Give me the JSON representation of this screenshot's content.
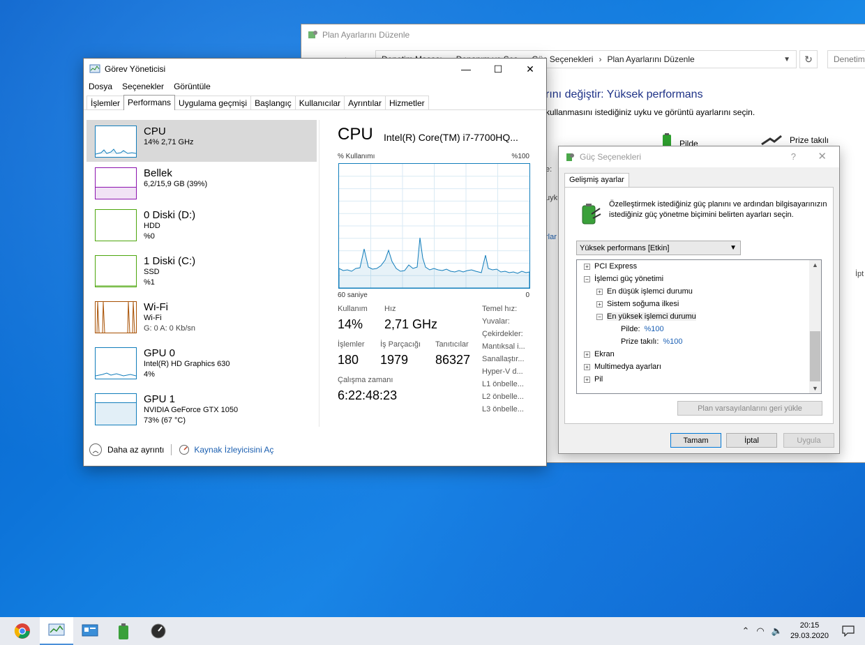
{
  "control_panel": {
    "title": "Plan Ayarlarını Düzenle",
    "breadcrumb": [
      "Denetim Masası",
      "Donanım ve Ses",
      "Güç Seçenekleri",
      "Plan Ayarlarını Düzenle"
    ],
    "search_placeholder": "Denetim",
    "heading_fragment": "rını değiştir: Yüksek performans",
    "subheading_fragment": "kullanmasını istediğiniz uyku ve görüntü ayarlarını seçin.",
    "col_battery": "Pilde",
    "col_plugged": "Prize takılı",
    "frag_1": "e:",
    "frag_2": "uyku",
    "frag_3": "rlar",
    "frag_4": "İpt"
  },
  "task_manager": {
    "title": "Görev Yöneticisi",
    "menu": [
      "Dosya",
      "Seçenekler",
      "Görüntüle"
    ],
    "tabs": [
      "İşlemler",
      "Performans",
      "Uygulama geçmişi",
      "Başlangıç",
      "Kullanıcılar",
      "Ayrıntılar",
      "Hizmetler"
    ],
    "items": [
      {
        "name": "CPU",
        "l1": "14% 2,71 GHz",
        "l2": "",
        "l3": ""
      },
      {
        "name": "Bellek",
        "l1": "6,2/15,9 GB (39%)",
        "l2": "",
        "l3": ""
      },
      {
        "name": "0 Diski (D:)",
        "l1": "HDD",
        "l2": "%0",
        "l3": ""
      },
      {
        "name": "1 Diski (C:)",
        "l1": "SSD",
        "l2": "%1",
        "l3": ""
      },
      {
        "name": "Wi-Fi",
        "l1": "Wi-Fi",
        "l2": "G: 0 A: 0 Kb/sn",
        "l3": ""
      },
      {
        "name": "GPU 0",
        "l1": "Intel(R) HD Graphics 630",
        "l2": "4%",
        "l3": ""
      },
      {
        "name": "GPU 1",
        "l1": "NVIDIA GeForce GTX 1050",
        "l2": "73% (67 °C)",
        "l3": ""
      }
    ],
    "detail": {
      "title": "CPU",
      "model": "Intel(R) Core(TM) i7-7700HQ...",
      "graph_label": "% Kullanımı",
      "graph_max": "%100",
      "axis_left": "60 saniye",
      "axis_right": "0",
      "usage_label": "Kullanım",
      "usage_value": "14%",
      "speed_label": "Hız",
      "speed_value": "2,71 GHz",
      "processes_label": "İşlemler",
      "processes_value": "180",
      "threads_label": "İş Parçacığı",
      "threads_value": "1979",
      "handles_label": "Tanıtıcılar",
      "handles_value": "86327",
      "uptime_label": "Çalışma zamanı",
      "uptime_value": "6:22:48:23",
      "side_labels": [
        "Temel hız:",
        "Yuvalar:",
        "Çekirdekler:",
        "Mantıksal i...",
        "Sanallaştır...",
        "Hyper-V d...",
        "L1 önbelle...",
        "L2 önbelle...",
        "L3 önbelle..."
      ]
    },
    "footer_less": "Daha az ayrıntı",
    "footer_link": "Kaynak İzleyicisini Aç"
  },
  "power_options": {
    "title": "Güç Seçenekleri",
    "help": "?",
    "tab": "Gelişmiş ayarlar",
    "description": "Özelleştirmek istediğiniz güç planını ve ardından bilgisayarınızın istediğiniz güç yönetme biçimini belirten ayarları seçin.",
    "plan_selected": "Yüksek performans [Etkin]",
    "tree": [
      {
        "label": "PCI Express",
        "exp": "+",
        "value": ""
      },
      {
        "label": "İşlemci güç yönetimi",
        "exp": "−",
        "value": ""
      },
      {
        "label": "En düşük işlemci durumu",
        "exp": "+",
        "value": ""
      },
      {
        "label": "Sistem soğuma ilkesi",
        "exp": "+",
        "value": ""
      },
      {
        "label": "En yüksek işlemci durumu",
        "exp": "−",
        "value": ""
      },
      {
        "label": "Pilde:",
        "exp": "",
        "value": "%100"
      },
      {
        "label": "Prize takılı:",
        "exp": "",
        "value": "%100"
      },
      {
        "label": "Ekran",
        "exp": "+",
        "value": ""
      },
      {
        "label": "Multimedya ayarları",
        "exp": "+",
        "value": ""
      },
      {
        "label": "Pil",
        "exp": "+",
        "value": ""
      }
    ],
    "restore_button": "Plan varsayılanlarını geri yükle",
    "ok_button": "Tamam",
    "cancel_button": "İptal",
    "apply_button": "Uygula"
  },
  "taskbar": {
    "time": "20:15",
    "date": "29.03.2020"
  },
  "colors": {
    "cpu": "#117dbb",
    "memory": "#8b12ae",
    "disk": "#4da60c",
    "wifi": "#a74f01",
    "gpu": "#117dbb"
  }
}
